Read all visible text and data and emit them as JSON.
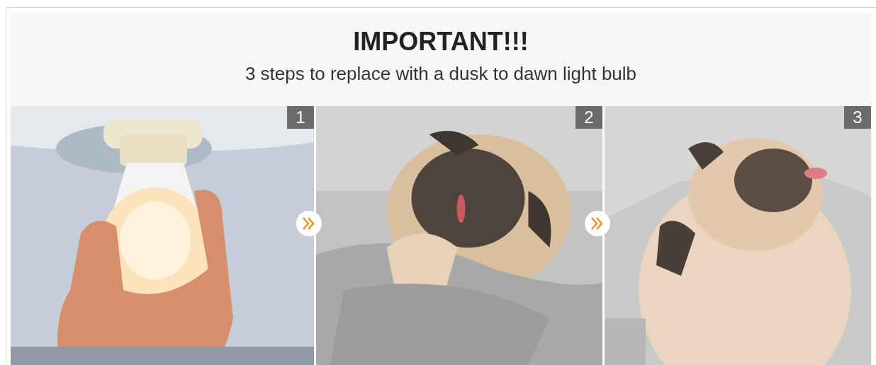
{
  "header": {
    "title": "IMPORTANT!!!",
    "subtitle": "3 steps to replace with a dusk to dawn light bulb"
  },
  "steps": [
    {
      "number": "1",
      "kind": "picture"
    },
    {
      "number": "2",
      "kind": "picture"
    },
    {
      "number": "3",
      "kind": "picture"
    }
  ]
}
